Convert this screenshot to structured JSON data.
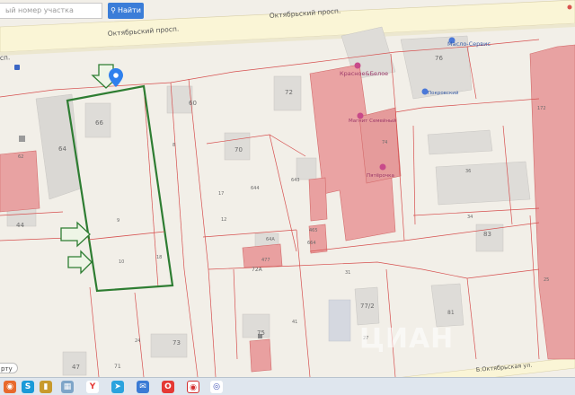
{
  "search": {
    "placeholder": "ый номер участка",
    "button_label": "Найти"
  },
  "streets": {
    "top_label": "Октябрьский просп.",
    "left_label": "Октябрьский просп.",
    "left_partial": "сп.",
    "bottom_label": "Б.Октябрьская ул."
  },
  "pois": {
    "red_store": "Красное&Белое",
    "magnit": "Магнит Семейный",
    "auto": "Масло-Сервис",
    "pokrovsky": "Покровский",
    "pyaterochka": "Пятёрочка"
  },
  "help_tab": "рту",
  "watermark": "ЦИАН",
  "house_numbers": {
    "h66": "66",
    "h64": "64",
    "h62": "62",
    "h44": "44",
    "h60": "60",
    "h72": "72",
    "h70": "70",
    "h76": "76",
    "h74": "74",
    "h83": "83",
    "h73": "73",
    "h75": "75",
    "h47": "47",
    "h71": "71",
    "h77_2": "77/2",
    "h81": "81",
    "h64a": "64А",
    "h72a": "72А",
    "h8": "8",
    "h9": "9",
    "h10": "10",
    "h12": "12",
    "h17": "17",
    "h18": "18",
    "h36": "36",
    "h34": "34",
    "h31": "31",
    "h41": "41",
    "h27": "27",
    "h24": "24",
    "h172": "172",
    "h25": "25",
    "h643": "643",
    "h644": "644",
    "h477": "477",
    "h465": "465",
    "h664": "664"
  },
  "colors": {
    "plot_outline": "#2e7d32",
    "arrow_fill": "#eaf3e2",
    "cadastre_line": "#d84a4a",
    "red_building": "#e8a4a4",
    "grey_building": "#dadada",
    "road": "#fbf6d8",
    "map_pin": "#2f80ed"
  },
  "taskbar": [
    "Firefox",
    "Skype",
    "Explorer",
    "Yandex",
    "Telegram",
    "Mail",
    "Opera",
    "Chrome",
    "WiFi"
  ]
}
